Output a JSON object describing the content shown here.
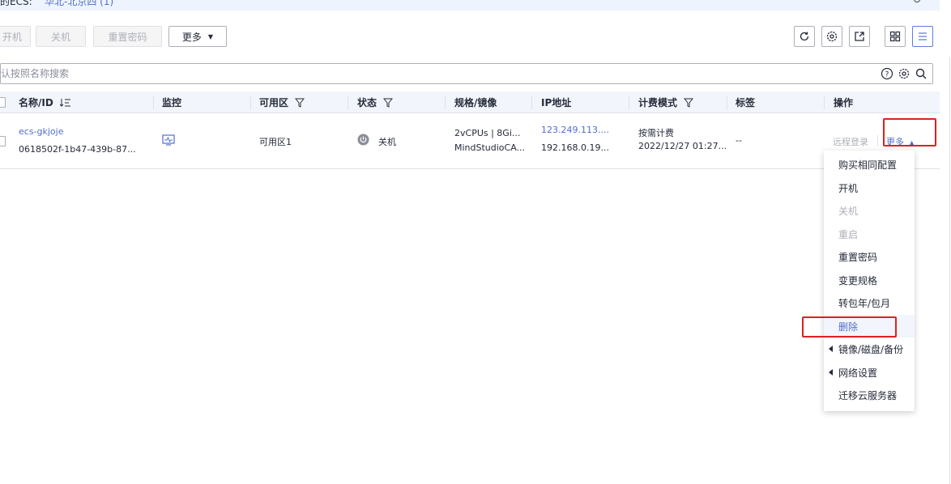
{
  "topbar": {
    "prefix": "的ECS:",
    "region": "华北-北京四 (1)"
  },
  "toolbar": {
    "start_label": "开机",
    "stop_label": "关机",
    "reset_password_label": "重置密码",
    "more_label": "更多"
  },
  "search": {
    "placeholder": "默认按照名称搜索"
  },
  "table": {
    "headers": {
      "name": "名称/ID",
      "monitor": "监控",
      "az": "可用区",
      "status": "状态",
      "spec": "规格/镜像",
      "ip": "IP地址",
      "billing": "计费模式",
      "tags": "标签",
      "actions": "操作"
    },
    "rows": [
      {
        "name": "ecs-gkjoje",
        "id": "0618502f-1b47-439b-87...",
        "az": "可用区1",
        "status": "关机",
        "spec_line1": "2vCPUs | 8Gi...",
        "spec_line2": "MindStudioCA...",
        "ip_public": "123.249.113....",
        "ip_private": "192.168.0.19...",
        "billing_line1": "按需计费",
        "billing_line2": "2022/12/27 01:27...",
        "tags": "--",
        "remote_login": "远程登录",
        "more": "更多"
      }
    ]
  },
  "menu": {
    "items": [
      {
        "label": "购买相同配置",
        "state": "enabled"
      },
      {
        "label": "开机",
        "state": "enabled"
      },
      {
        "label": "关机",
        "state": "disabled"
      },
      {
        "label": "重启",
        "state": "disabled"
      },
      {
        "label": "重置密码",
        "state": "enabled"
      },
      {
        "label": "变更规格",
        "state": "enabled"
      },
      {
        "label": "转包年/包月",
        "state": "enabled"
      },
      {
        "label": "删除",
        "state": "selected"
      },
      {
        "label": "镜像/磁盘/备份",
        "state": "submenu"
      },
      {
        "label": "网络设置",
        "state": "submenu"
      },
      {
        "label": "迁移云服务器",
        "state": "enabled"
      }
    ]
  },
  "colors": {
    "link": "#526ecc",
    "highlight": "#e02020",
    "disabled": "#adb0b8",
    "header_bg": "#f2f5fc"
  }
}
